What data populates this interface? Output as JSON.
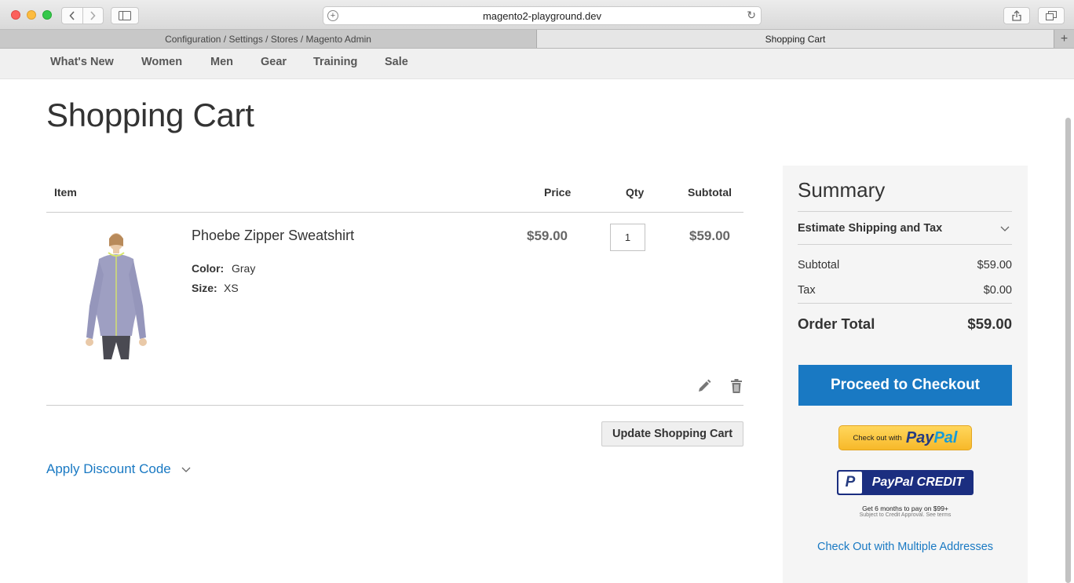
{
  "browser": {
    "url": "magento2-playground.dev",
    "tabs": [
      {
        "label": "Configuration / Settings / Stores / Magento Admin",
        "active": false
      },
      {
        "label": "Shopping Cart",
        "active": true
      }
    ],
    "new_tab_symbol": "+"
  },
  "store_nav": {
    "items": [
      "What's New",
      "Women",
      "Men",
      "Gear",
      "Training",
      "Sale"
    ]
  },
  "page": {
    "title": "Shopping Cart"
  },
  "cart": {
    "headers": {
      "item": "Item",
      "price": "Price",
      "qty": "Qty",
      "subtotal": "Subtotal"
    },
    "items": [
      {
        "name": "Phoebe Zipper Sweatshirt",
        "options": [
          {
            "label": "Color:",
            "value": "Gray"
          },
          {
            "label": "Size:",
            "value": "XS"
          }
        ],
        "price": "$59.00",
        "qty": "1",
        "subtotal": "$59.00"
      }
    ],
    "update_label": "Update Shopping Cart",
    "discount_label": "Apply Discount Code"
  },
  "summary": {
    "title": "Summary",
    "estimate_label": "Estimate Shipping and Tax",
    "subtotal_label": "Subtotal",
    "subtotal_value": "$59.00",
    "tax_label": "Tax",
    "tax_value": "$0.00",
    "order_total_label": "Order Total",
    "order_total_value": "$59.00",
    "checkout_label": "Proceed to Checkout",
    "paypal_small": "Check out with",
    "paypal_pay": "Pay",
    "paypal_pal": "Pal",
    "paypal_credit": "PayPal CREDIT",
    "credit_line1": "Get 6 months to pay on $99+",
    "credit_line2": "Subject to Credit Approval. See terms",
    "multi_address_label": "Check Out with Multiple Addresses"
  },
  "colors": {
    "accent": "#1979c3",
    "paypal_yellow": "#ffc439",
    "paypal_navy": "#1b2e80"
  }
}
